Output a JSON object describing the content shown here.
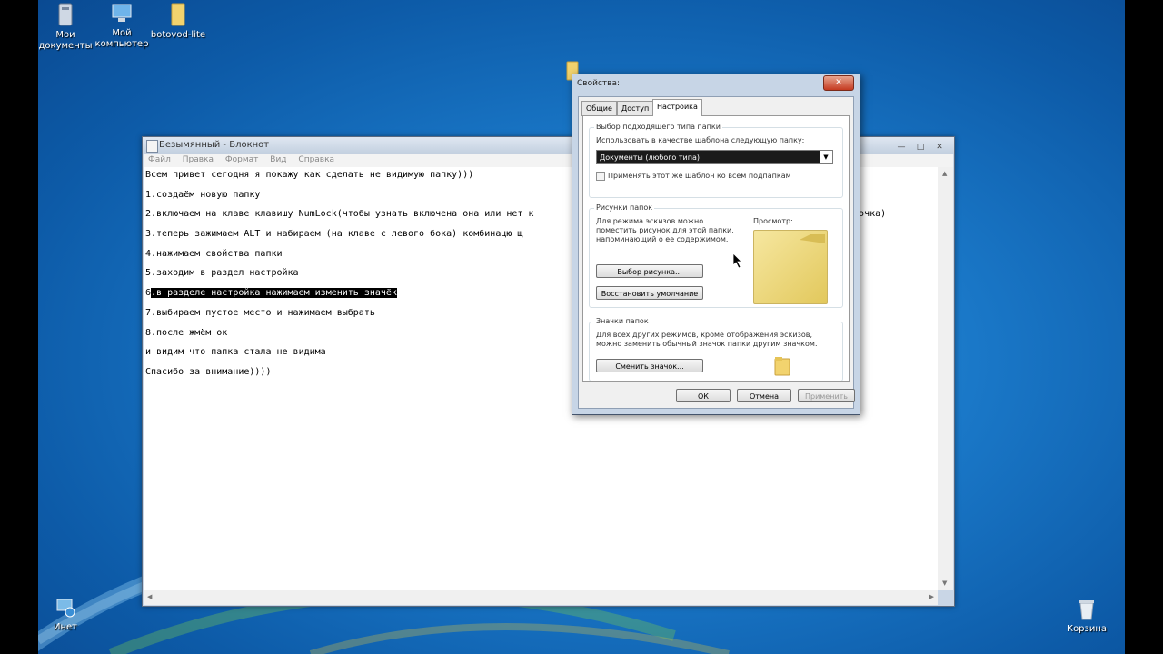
{
  "desktop": {
    "icons": [
      {
        "label": "Мои документы",
        "icon": "my-documents-icon"
      },
      {
        "label": "Мой компьютер",
        "icon": "computer-icon"
      },
      {
        "label": "botovod-lite",
        "icon": "folder-icon"
      },
      {
        "label": "Инет",
        "icon": "network-icon"
      },
      {
        "label": "Корзина",
        "icon": "recycle-bin-icon"
      }
    ]
  },
  "notepad": {
    "title": "Безымянный - Блокнот",
    "menu": [
      "Файл",
      "Правка",
      "Формат",
      "Вид",
      "Справка"
    ],
    "lines": [
      "Всем привет сегодня я покажу как сделать не видимую папку)))",
      "1.создаём новую папку",
      "2.включаем на клаве клавишу NumLock(чтобы узнать включена она или нет к",
      "3.теперь зажимаем ALT и набираем (на клаве с левого бока) комбинацю щ",
      "4.нажимаем свойства папки",
      "5.заходим в раздел настройка",
      "6.в разделе настройка нажимаем изменить значёк",
      "7.выбираем пустое место и нажимаем выбрать",
      "8.после жмём ок",
      "и видим что папка стала не видима",
      "Спасибо за внимание))))"
    ],
    "line2_tail": "ампочка)",
    "selected_line_prefix": "6",
    "selected_line_rest": ".в разделе настройка нажимаем изменить значёк"
  },
  "dialog": {
    "title": "Свойства:",
    "tabs": [
      "Общие",
      "Доступ",
      "Настройка"
    ],
    "group_type": {
      "label": "Выбор подходящего типа папки",
      "prompt": "Использовать в качестве шаблона следующую папку:",
      "combo_value": "Документы (любого типа)",
      "checkbox_label": "Применять этот же шаблон ко всем подпапкам"
    },
    "group_pictures": {
      "label": "Рисунки папок",
      "text": "Для режима эскизов можно поместить рисунок для этой папки, напоминающий о ее содержимом.",
      "preview_label": "Просмотр:",
      "choose_button": "Выбор рисунка...",
      "restore_button": "Восстановить умолчание"
    },
    "group_icons": {
      "label": "Значки папок",
      "text": "Для всех других режимов, кроме отображения эскизов, можно заменить обычный значок папки другим значком.",
      "change_button": "Сменить значок..."
    },
    "buttons": {
      "ok": "ОК",
      "cancel": "Отмена",
      "apply": "Применить"
    }
  }
}
